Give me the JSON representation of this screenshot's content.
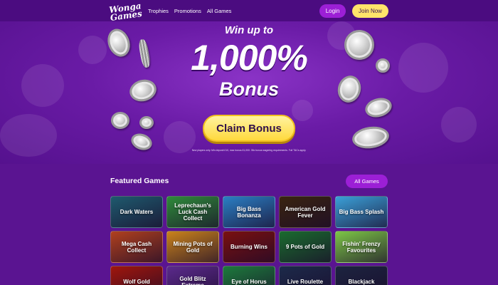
{
  "header": {
    "logo_line1": "Wonga",
    "logo_line2": "Games",
    "nav": [
      "Trophies",
      "Promotions",
      "All Games"
    ],
    "login_label": "Login",
    "join_label": "Join Now"
  },
  "hero": {
    "line1": "Win up to",
    "line2": "1,000%",
    "line3": "Bonus",
    "cta_label": "Claim Bonus",
    "terms": "New players only. Min deposit £10, max bonus £1,000. 35x bonus wagering requirements. Full T&Cs apply."
  },
  "featured": {
    "title": "Featured Games",
    "all_games_label": "All Games",
    "games": [
      {
        "name": "Dark Waters",
        "color": "#1e5a6e"
      },
      {
        "name": "Leprechaun's Luck Cash Collect",
        "color": "#2e8b3a"
      },
      {
        "name": "Big Bass Bonanza",
        "color": "#2a7fc4"
      },
      {
        "name": "American Gold Fever",
        "color": "#3a2410"
      },
      {
        "name": "Big Bass Splash",
        "color": "#3aa0d8"
      },
      {
        "name": "Mega Cash Collect",
        "color": "#b0401e"
      },
      {
        "name": "Mining Pots of Gold",
        "color": "#c9821c"
      },
      {
        "name": "Burning Wins",
        "color": "#7a1010"
      },
      {
        "name": "9 Pots of Gold",
        "color": "#1a6b2e"
      },
      {
        "name": "Fishin' Frenzy Favourites",
        "color": "#7cc646"
      },
      {
        "name": "Wolf Gold",
        "color": "#a0160c"
      },
      {
        "name": "Gold Blitz Extreme",
        "color": "#5b2a8c"
      },
      {
        "name": "Eye of Horus",
        "color": "#1c7a3c"
      },
      {
        "name": "Live Roulette",
        "color": "#1c2a4a"
      },
      {
        "name": "Blackjack",
        "color": "#1c2440"
      }
    ]
  }
}
